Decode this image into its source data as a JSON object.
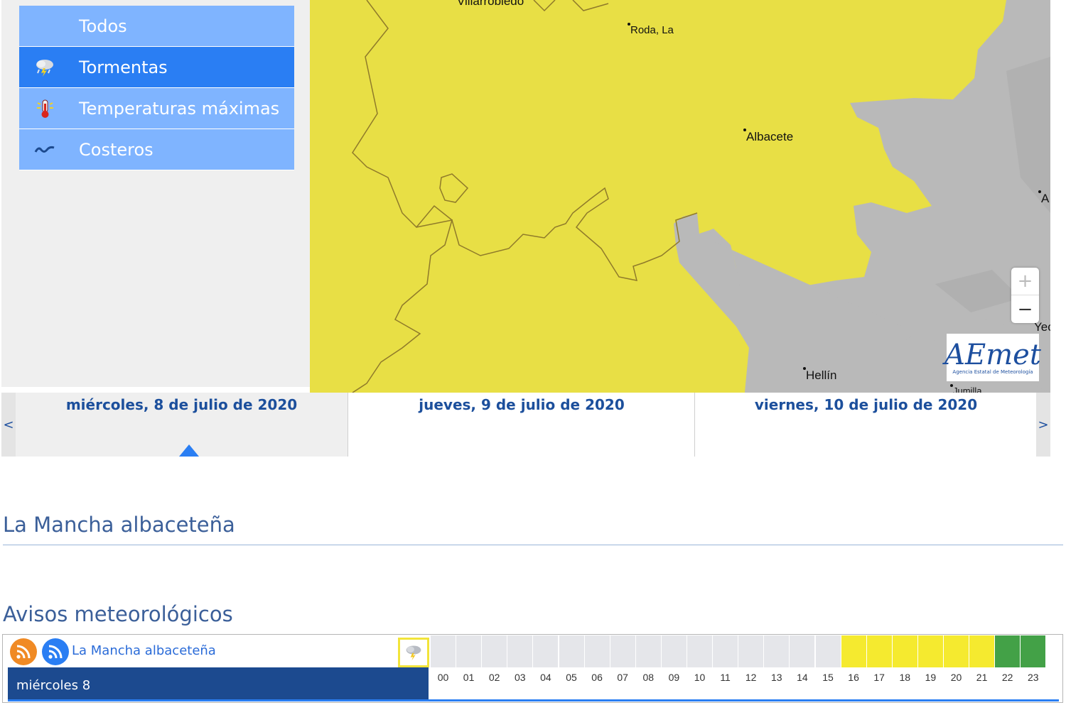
{
  "menu": {
    "items": [
      {
        "label": "Todos",
        "icon": "none",
        "active": false
      },
      {
        "label": "Tormentas",
        "icon": "storm-icon",
        "active": true
      },
      {
        "label": "Temperaturas máximas",
        "icon": "thermometer-icon",
        "active": false
      },
      {
        "label": "Costeros",
        "icon": "waves-icon",
        "active": false
      }
    ]
  },
  "map": {
    "cities": {
      "villarrobledo": "Villarrobledo",
      "roda": "Roda, La",
      "albacete": "Albacete",
      "hellin": "Hellín",
      "jumilla": "Jumilla",
      "a_edge": "A",
      "yecla_edge": "Yec"
    },
    "zoom_in": "+",
    "zoom_out": "−",
    "logo": {
      "text": "AEmet",
      "subtitle": "Agencia Estatal de Meteorología"
    },
    "colors": {
      "warning_yellow": "#e8df45",
      "terrain_gray": "#b9b9b9"
    }
  },
  "dates": {
    "prev": "<",
    "next": ">",
    "tabs": [
      {
        "label": "miércoles, 8 de julio de 2020",
        "selected": true
      },
      {
        "label": "jueves, 9 de julio de 2020",
        "selected": false
      },
      {
        "label": "viernes, 10 de julio de 2020",
        "selected": false
      }
    ]
  },
  "zone": {
    "title": "La Mancha albaceteña"
  },
  "avisos": {
    "title": "Avisos meteorológicos",
    "zone_link": "La Mancha albaceteña",
    "day": "miércoles 8",
    "hours": [
      "00",
      "01",
      "02",
      "03",
      "04",
      "05",
      "06",
      "07",
      "08",
      "09",
      "10",
      "11",
      "12",
      "13",
      "14",
      "15",
      "16",
      "17",
      "18",
      "19",
      "20",
      "21",
      "22",
      "23"
    ],
    "levels": [
      "none",
      "none",
      "none",
      "none",
      "none",
      "none",
      "none",
      "none",
      "none",
      "none",
      "none",
      "none",
      "none",
      "none",
      "none",
      "none",
      "yellow",
      "yellow",
      "yellow",
      "yellow",
      "yellow",
      "yellow",
      "green",
      "green"
    ],
    "colors": {
      "none": "#e5e6ea",
      "yellow": "#f5ea2f",
      "green": "#43a147"
    }
  }
}
